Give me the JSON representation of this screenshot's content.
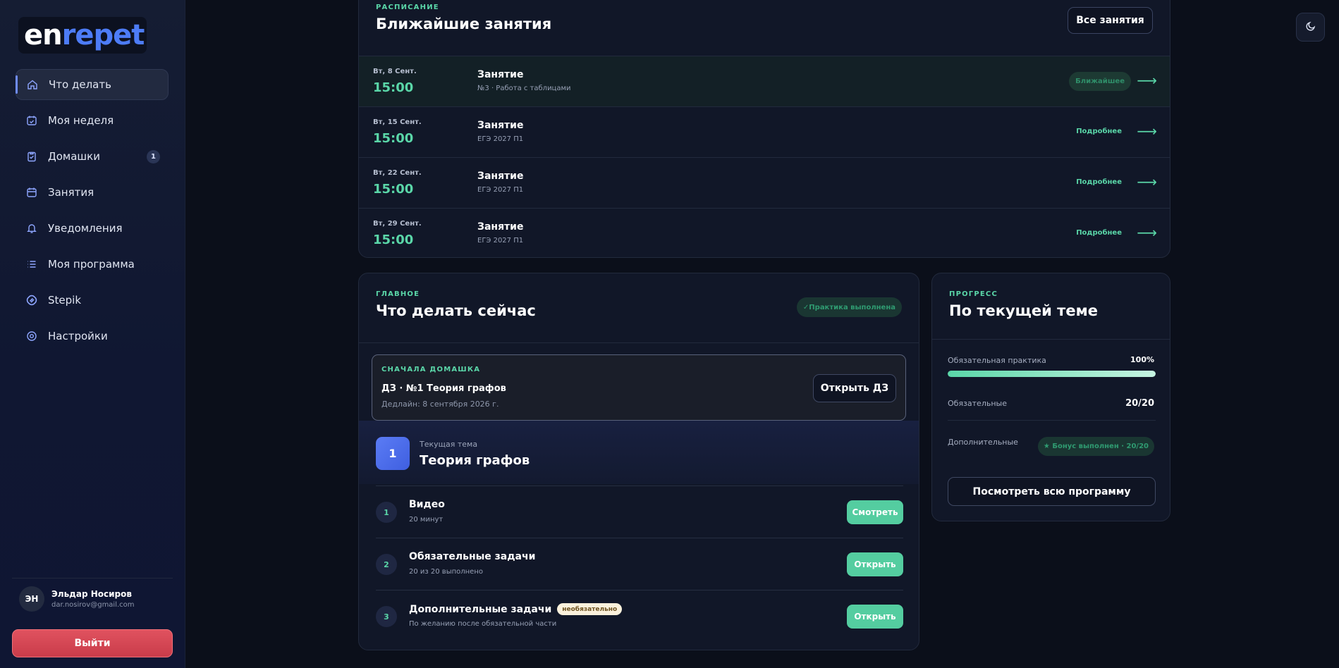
{
  "brand": {
    "logo_a": "en",
    "logo_b": "repet"
  },
  "sidebar": {
    "items": [
      {
        "label": "Что делать",
        "icon": "home-icon"
      },
      {
        "label": "Моя неделя",
        "icon": "calendar-check-icon"
      },
      {
        "label": "Домашки",
        "icon": "clipboard-icon",
        "badge": "1"
      },
      {
        "label": "Занятия",
        "icon": "calendar-icon"
      },
      {
        "label": "Уведомления",
        "icon": "bell-icon"
      },
      {
        "label": "Моя программа",
        "icon": "list-icon"
      },
      {
        "label": "Stepik",
        "icon": "stepik-icon"
      },
      {
        "label": "Настройки",
        "icon": "settings-icon"
      }
    ],
    "user": {
      "initials": "ЭН",
      "name": "Эльдар Носиров",
      "email": "dar.nosirov@gmail.com"
    },
    "logout_label": "Выйти"
  },
  "schedule": {
    "eyebrow": "РАСПИСАНИЕ",
    "title": "Ближайшие занятия",
    "all_label": "Все занятия",
    "rows": [
      {
        "date": "Вт, 8 Сент.",
        "time": "15:00",
        "name": "Занятие",
        "sub": "№3 · Работа с таблицами",
        "status": "Ближайшее"
      },
      {
        "date": "Вт, 15 Сент.",
        "time": "15:00",
        "name": "Занятие",
        "sub": "ЕГЭ 2027 П1",
        "status": "Подробнее"
      },
      {
        "date": "Вт, 22 Сент.",
        "time": "15:00",
        "name": "Занятие",
        "sub": "ЕГЭ 2027 П1",
        "status": "Подробнее"
      },
      {
        "date": "Вт, 29 Сент.",
        "time": "15:00",
        "name": "Занятие",
        "sub": "ЕГЭ 2027 П1",
        "status": "Подробнее"
      }
    ]
  },
  "main": {
    "eyebrow": "ГЛАВНОЕ",
    "title": "Что делать сейчас",
    "practice_pill": "✓Практика выполнена",
    "homework": {
      "eyebrow": "СНАЧАЛА ДОМАШКА",
      "title": "ДЗ · №1 Теория графов",
      "deadline": "Дедлайн: 8 сентября 2026 г.",
      "open_label": "Открыть ДЗ"
    },
    "topic": {
      "number": "1",
      "label": "Текущая тема",
      "title": "Теория графов"
    },
    "tasks": [
      {
        "num": "1",
        "title": "Видео",
        "sub": "20 минут",
        "button": "Смотреть"
      },
      {
        "num": "2",
        "title": "Обязательные задачи",
        "sub": "20 из 20 выполнено",
        "button": "Открыть"
      },
      {
        "num": "3",
        "title": "Дополнительные задачи",
        "badge": "необязательно",
        "sub": "По желанию после обязательной части",
        "button": "Открыть"
      }
    ]
  },
  "progress": {
    "eyebrow": "ПРОГРЕСС",
    "title": "По текущей теме",
    "practice_label": "Обязательная практика",
    "practice_value": "100%",
    "practice_fraction": 1.0,
    "required_label": "Обязательные",
    "required_value": "20/20",
    "extra_label": "Дополнительные",
    "extra_pill": "★ Бонус выполнен · 20/20",
    "program_label": "Посмотреть всю программу"
  },
  "colors": {
    "accent": "#5ad6a8",
    "brand_blue": "#4d7cf6",
    "danger": "#d94a57"
  }
}
